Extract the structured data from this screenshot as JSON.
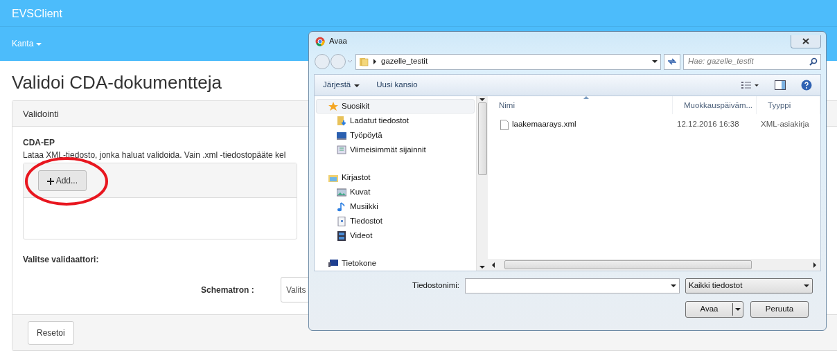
{
  "page": {
    "brand": "EVSClient",
    "nav_menu": {
      "label": "Kanta"
    },
    "title": "Validoi CDA-dokumentteja",
    "panel": {
      "heading": "Validointi",
      "section_title": "CDA-EP",
      "description": "Lataa XML-tiedosto, jonka haluat validoida. Vain .xml -tiedostopääte kel",
      "add_button": "Add...",
      "validator_label": "Valitse validaattori:",
      "schematron_label": "Schematron :",
      "schematron_select": "Valits",
      "reset_button": "Resetoi"
    }
  },
  "dialog": {
    "title": "Avaa",
    "breadcrumb": "gazelle_testit",
    "search": {
      "placeholder": "Hae: gazelle_testit"
    },
    "toolbar": [
      {
        "label": "Järjestä",
        "dropdown": true
      },
      {
        "label": "Uusi kansio",
        "dropdown": false
      }
    ],
    "tree": [
      {
        "label": "Suosikit",
        "kind": "favorites",
        "selected": true,
        "children": [
          {
            "label": "Ladatut tiedostot",
            "kind": "downloads",
            "selected": false
          },
          {
            "label": "Työpöytä",
            "kind": "desktop",
            "selected": false
          },
          {
            "label": "Viimeisimmät sijainnit",
            "kind": "recent",
            "selected": false
          }
        ]
      },
      {
        "label": "Kirjastot",
        "kind": "libraries",
        "selected": false,
        "children": [
          {
            "label": "Kuvat",
            "kind": "pictures",
            "selected": false
          },
          {
            "label": "Musiikki",
            "kind": "music",
            "selected": false
          },
          {
            "label": "Tiedostot",
            "kind": "documents",
            "selected": false
          },
          {
            "label": "Videot",
            "kind": "videos",
            "selected": false
          }
        ]
      },
      {
        "label": "Tietokone",
        "kind": "computer",
        "selected": false
      }
    ],
    "columns": [
      {
        "label": "Nimi",
        "sorted": true
      },
      {
        "label": "Muokkauspäiväm...",
        "sorted": false
      },
      {
        "label": "Tyyppi",
        "sorted": false
      }
    ],
    "files": [
      {
        "name": "laakemaarays.xml",
        "modified": "12.12.2016 16:38",
        "type": "XML-asiakirja"
      }
    ],
    "filename_label": "Tiedostonimi:",
    "filetype": "Kaikki tiedostot",
    "open_button": "Avaa",
    "cancel_button": "Peruuta"
  }
}
